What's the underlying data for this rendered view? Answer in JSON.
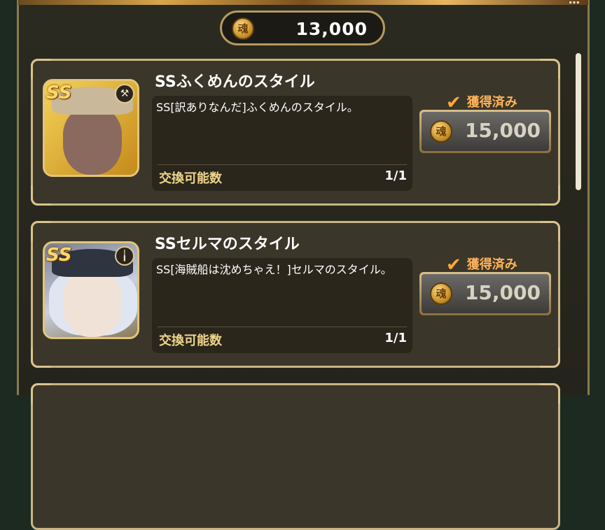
{
  "header": {
    "top_right_text": "…",
    "balance": "13,000",
    "coin_glyph": "魂"
  },
  "items": [
    {
      "name": "SSふくめんのスタイル",
      "description": "SS[訳ありなんだ]ふくめんのスタイル。",
      "exchange_label": "交換可能数",
      "exchange_count": "1/1",
      "status": "獲得済み",
      "price": "15,000",
      "badge": "SS",
      "type_icon": "hammer-icon",
      "type_glyph": "⚒"
    },
    {
      "name": "SSセルマのスタイル",
      "description": "SS[海賊船は沈めちゃえ！]セルマのスタイル。",
      "exchange_label": "交換可能数",
      "exchange_count": "1/1",
      "status": "獲得済み",
      "price": "15,000",
      "badge": "SS",
      "type_icon": "staff-icon",
      "type_glyph": "╽"
    }
  ],
  "colors": {
    "accent_gold": "#c9b583",
    "status_orange": "#ffb45a",
    "label_gold": "#f0d68a"
  }
}
